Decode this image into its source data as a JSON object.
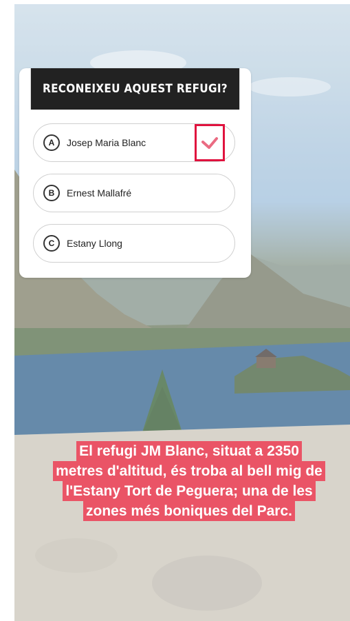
{
  "quiz": {
    "question": "RECONEIXEU AQUEST REFUGI?",
    "options": [
      {
        "letter": "A",
        "label": "Josep Maria Blanc",
        "selected": true
      },
      {
        "letter": "B",
        "label": "Ernest Mallafré",
        "selected": false
      },
      {
        "letter": "C",
        "label": "Estany Llong",
        "selected": false
      }
    ]
  },
  "caption": {
    "lines": [
      "El refugi JM Blanc, situat a 2350",
      "metres d'altitud, és troba al bell mig de",
      "l'Estany Tort de Peguera; una de les",
      "zones més boniques del Parc."
    ]
  },
  "colors": {
    "header": "#222222",
    "caption_bg": "#ea5466",
    "check": "#e0123e"
  }
}
